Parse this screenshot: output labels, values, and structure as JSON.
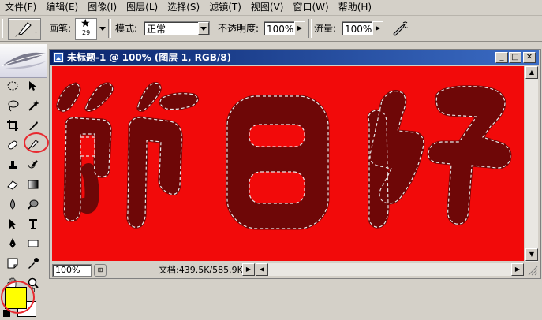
{
  "menu": [
    "文件(F)",
    "编辑(E)",
    "图像(I)",
    "图层(L)",
    "选择(S)",
    "滤镜(T)",
    "视图(V)",
    "窗口(W)",
    "帮助(H)"
  ],
  "options": {
    "brush_label": "画笔:",
    "brush_size": "29",
    "mode_label": "模式:",
    "mode_value": "正常",
    "opacity_label": "不透明度:",
    "opacity_value": "100%",
    "flow_label": "流量:",
    "flow_value": "100%"
  },
  "document": {
    "title": "未标题-1 @ 100% (图层 1, RGB/8)",
    "canvas_text": "節日好",
    "canvas_color": "#f20a0a",
    "text_color": "#6e0707"
  },
  "status": {
    "zoom": "100%",
    "doc_info": "文档:439.5K/585.9K"
  },
  "colors": {
    "foreground": "#ffff00",
    "background": "#ffffff",
    "highlight_circle": "#e8292f"
  },
  "tools": [
    "marquee-icon",
    "move-icon",
    "lasso-icon",
    "magic-wand-icon",
    "crop-icon",
    "slice-icon",
    "healing-brush-icon",
    "brush-icon",
    "clone-stamp-icon",
    "history-brush-icon",
    "eraser-icon",
    "gradient-icon",
    "blur-icon",
    "dodge-icon",
    "path-select-icon",
    "type-icon",
    "pen-icon",
    "rectangle-icon",
    "notes-icon",
    "eyedropper-icon",
    "hand-icon",
    "zoom-icon"
  ]
}
